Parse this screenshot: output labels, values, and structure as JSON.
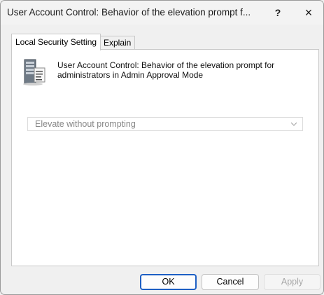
{
  "window": {
    "title": "User Account Control: Behavior of the elevation prompt f...",
    "help_label": "?",
    "close_label": "×"
  },
  "tabs": [
    {
      "label": "Local Security Setting",
      "active": true
    },
    {
      "label": "Explain",
      "active": false
    }
  ],
  "policy": {
    "icon": "server-policy-icon",
    "name_line1": "User Account Control: Behavior of the elevation prompt for",
    "name_line2": "administrators in Admin Approval Mode"
  },
  "setting": {
    "selected_value": "Elevate without prompting",
    "enabled": false
  },
  "buttons": {
    "ok": "OK",
    "cancel": "Cancel",
    "apply": "Apply"
  },
  "colors": {
    "accent": "#1d5fc4",
    "disabled_text": "#a6a6a6"
  }
}
